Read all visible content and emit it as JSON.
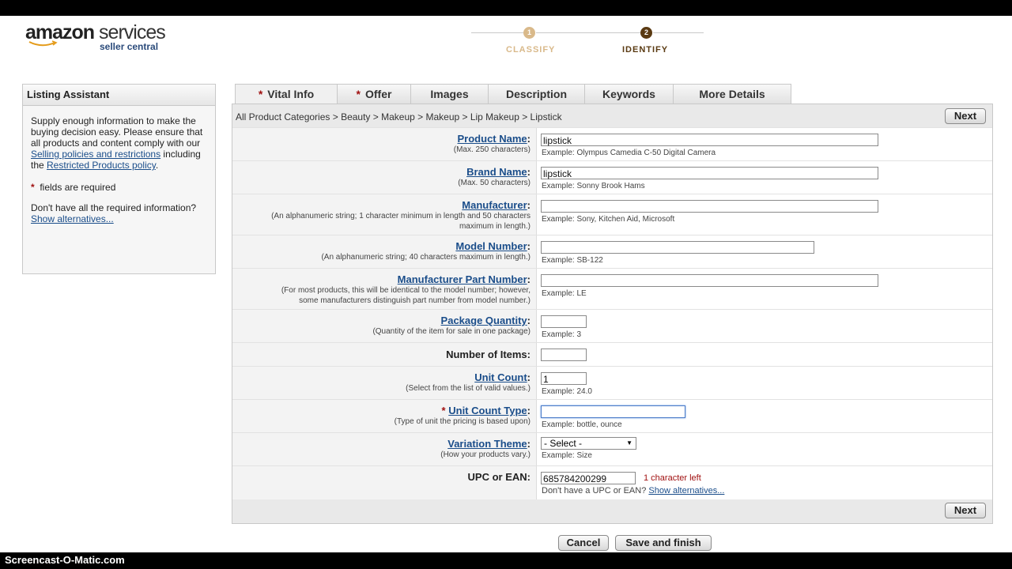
{
  "logo": {
    "line1_a": "amazon",
    "line1_b": "services",
    "line2": "seller central"
  },
  "steps": [
    {
      "num": "1",
      "label": "CLASSIFY",
      "state": "done"
    },
    {
      "num": "2",
      "label": "IDENTIFY",
      "state": "current"
    }
  ],
  "sidebar": {
    "title": "Listing Assistant",
    "para1_a": "Supply enough information to make the buying decision easy. Please ensure that all products and content comply with our ",
    "link_policies": "Selling policies and restrictions",
    "para1_b": " including the ",
    "link_restricted": "Restricted Products policy",
    "para1_c": ".",
    "required_star": "*",
    "required_text": "fields are required",
    "missing_text": "Don't have all the required information?",
    "show_alternatives": "Show alternatives..."
  },
  "tabs": [
    {
      "label": "Vital Info",
      "required": true,
      "active": true
    },
    {
      "label": "Offer",
      "required": true,
      "active": false
    },
    {
      "label": "Images",
      "required": false,
      "active": false
    },
    {
      "label": "Description",
      "required": false,
      "active": false
    },
    {
      "label": "Keywords",
      "required": false,
      "active": false
    },
    {
      "label": "More Details",
      "required": false,
      "active": false
    }
  ],
  "breadcrumb": "All Product Categories > Beauty > Makeup > Makeup > Lip Makeup > Lipstick",
  "buttons": {
    "next": "Next",
    "cancel": "Cancel",
    "save_finish": "Save and finish"
  },
  "fields": {
    "product_name": {
      "label": "Product Name",
      "hint": "(Max. 250 characters)",
      "value": "lipstick",
      "example": "Example:  Olympus Camedia C-50 Digital Camera"
    },
    "brand_name": {
      "label": "Brand Name",
      "hint": "(Max. 50 characters)",
      "value": "lipstick",
      "example": "Example:  Sonny Brook Hams"
    },
    "manufacturer": {
      "label": "Manufacturer",
      "hint1": "(An alphanumeric string; 1 character minimum in length and 50 characters",
      "hint2": "maximum in length.)",
      "value": "",
      "example": "Example:  Sony, Kitchen Aid, Microsoft"
    },
    "model_number": {
      "label": "Model Number",
      "hint": "(An alphanumeric string; 40 characters maximum in length.)",
      "value": "",
      "example": "Example:  SB-122"
    },
    "mpn": {
      "label": "Manufacturer Part Number",
      "hint1": "(For most products, this will be identical to the model number; however,",
      "hint2": "some manufacturers distinguish part number from model number.)",
      "value": "",
      "example": "Example:  LE"
    },
    "package_quantity": {
      "label": "Package Quantity",
      "hint": "(Quantity of the item for sale in one package)",
      "value": "",
      "example": "Example:  3"
    },
    "number_of_items": {
      "label": "Number of Items:",
      "value": ""
    },
    "unit_count": {
      "label": "Unit Count",
      "hint": "(Select from the list of valid values.)",
      "value": "1",
      "example": "Example:  24.0"
    },
    "unit_count_type": {
      "label": "Unit Count Type",
      "hint": "(Type of unit the pricing is based upon)",
      "value": "",
      "example": "Example:  bottle, ounce"
    },
    "variation_theme": {
      "label": "Variation Theme",
      "hint": "(How your products vary.)",
      "value": "- Select -",
      "example": "Example:  Size"
    },
    "upc": {
      "label": "UPC or EAN:",
      "value": "685784200299",
      "chars_left": "1 character left",
      "no_upc": "Don't have a UPC or EAN?",
      "show_alternatives": "Show alternatives..."
    }
  },
  "watermark": "Screencast-O-Matic.com",
  "colors": {
    "link": "#1a4d8a",
    "required": "#a01010",
    "step_done": "#d9b98a",
    "step_current": "#5a3a12"
  }
}
